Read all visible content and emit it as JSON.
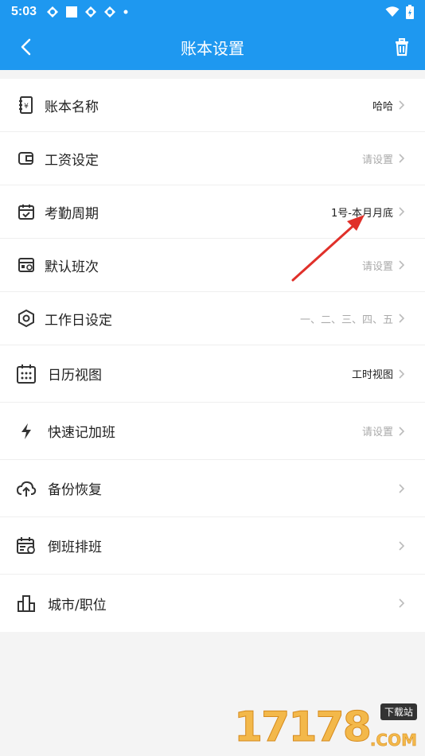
{
  "status_bar": {
    "time": "5:03"
  },
  "header": {
    "title": "账本设置"
  },
  "items": [
    {
      "label": "账本名称",
      "value": "哈哈",
      "muted": false,
      "icon": "ledger-icon"
    },
    {
      "label": "工资设定",
      "value": "请设置",
      "muted": true,
      "icon": "wallet-icon"
    },
    {
      "label": "考勤周期",
      "value": "1号-本月月底",
      "muted": false,
      "icon": "calendar-check-icon"
    },
    {
      "label": "默认班次",
      "value": "请设置",
      "muted": true,
      "icon": "shift-icon"
    },
    {
      "label": "工作日设定",
      "value": "一、二、三、四、五",
      "muted": true,
      "icon": "hexagon-icon"
    },
    {
      "label": "日历视图",
      "value": "工时视图",
      "muted": false,
      "icon": "calendar-grid-icon"
    },
    {
      "label": "快速记加班",
      "value": "请设置",
      "muted": true,
      "icon": "lightning-icon"
    },
    {
      "label": "备份恢复",
      "value": "",
      "muted": false,
      "icon": "cloud-upload-icon"
    },
    {
      "label": "倒班排班",
      "value": "",
      "muted": false,
      "icon": "calendar-clock-icon"
    },
    {
      "label": "城市/职位",
      "value": "",
      "muted": false,
      "icon": "city-icon"
    }
  ],
  "watermark": {
    "number": "17178",
    "tag": "下载站",
    "suffix": ".COM"
  },
  "colors": {
    "primary": "#1e98f0",
    "annotation": "#e0302a"
  }
}
